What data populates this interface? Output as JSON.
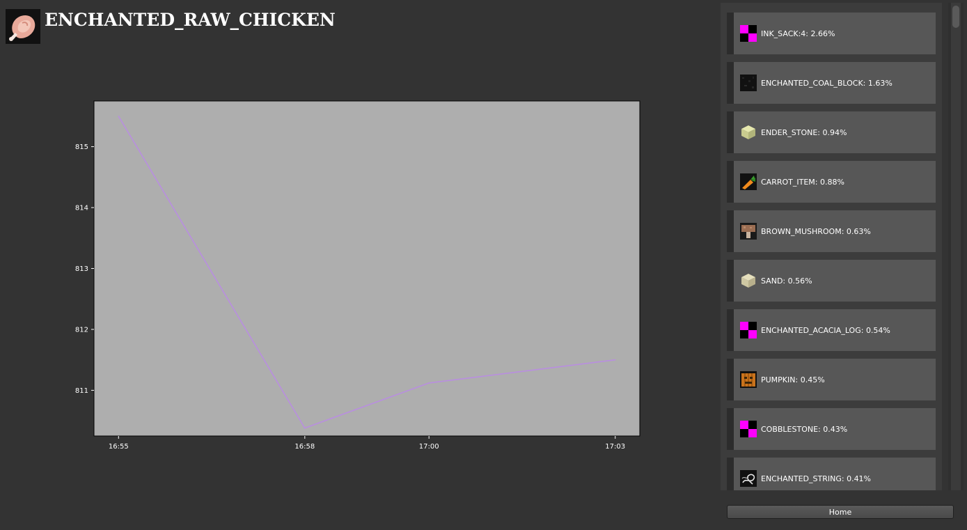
{
  "header": {
    "title": "ENCHANTED_RAW_CHICKEN",
    "icon": "raw-chicken-icon"
  },
  "chart_data": {
    "type": "line",
    "x": [
      "16:55",
      "16:58",
      "17:00",
      "17:03"
    ],
    "y": [
      815.5,
      810.38,
      811.12,
      811.5
    ],
    "xlim": [
      "16:55",
      "17:03"
    ],
    "ylim": [
      810.25,
      815.75
    ],
    "yticks": [
      811,
      812,
      813,
      814,
      815
    ],
    "xticks": [
      "16:55",
      "16:58",
      "17:00",
      "17:03"
    ],
    "grid": false,
    "line_color": "#b98ee0",
    "plot_background": "#aeaeae"
  },
  "sidebar": {
    "items": [
      {
        "label": "INK_SACK:4: 2.66%",
        "icon": "missing-texture-icon"
      },
      {
        "label": "ENCHANTED_COAL_BLOCK: 1.63%",
        "icon": "coal-block-icon"
      },
      {
        "label": "ENDER_STONE: 0.94%",
        "icon": "end-stone-icon"
      },
      {
        "label": "CARROT_ITEM: 0.88%",
        "icon": "carrot-icon"
      },
      {
        "label": "BROWN_MUSHROOM: 0.63%",
        "icon": "brown-mushroom-icon"
      },
      {
        "label": "SAND: 0.56%",
        "icon": "sand-icon"
      },
      {
        "label": "ENCHANTED_ACACIA_LOG: 0.54%",
        "icon": "missing-texture-icon"
      },
      {
        "label": "PUMPKIN: 0.45%",
        "icon": "pumpkin-icon"
      },
      {
        "label": "COBBLESTONE: 0.43%",
        "icon": "missing-texture-icon"
      },
      {
        "label": "ENCHANTED_STRING: 0.41%",
        "icon": "string-icon"
      }
    ]
  },
  "footer": {
    "home_label": "Home"
  }
}
